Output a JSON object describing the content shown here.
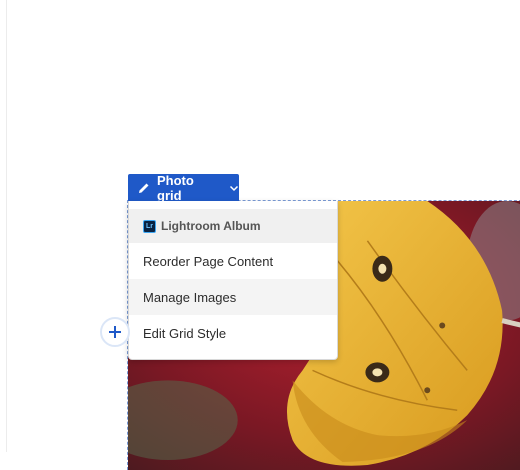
{
  "toolbar": {
    "block_label": "Photo grid",
    "pencil_icon": "pencil-icon",
    "chevron_icon": "chevron-down-icon"
  },
  "menu": {
    "header": {
      "label": "Lightroom Album",
      "badge": "Lr",
      "icon": "lightroom-icon"
    },
    "items": [
      {
        "label": "Reorder Page Content"
      },
      {
        "label": "Manage Images"
      },
      {
        "label": "Edit Grid Style"
      }
    ]
  },
  "add_block": {
    "icon": "plus-icon"
  },
  "colors": {
    "accent": "#1f59c8",
    "frame_dash": "#7a9bd6",
    "lightroom_badge": "#0a2342"
  }
}
